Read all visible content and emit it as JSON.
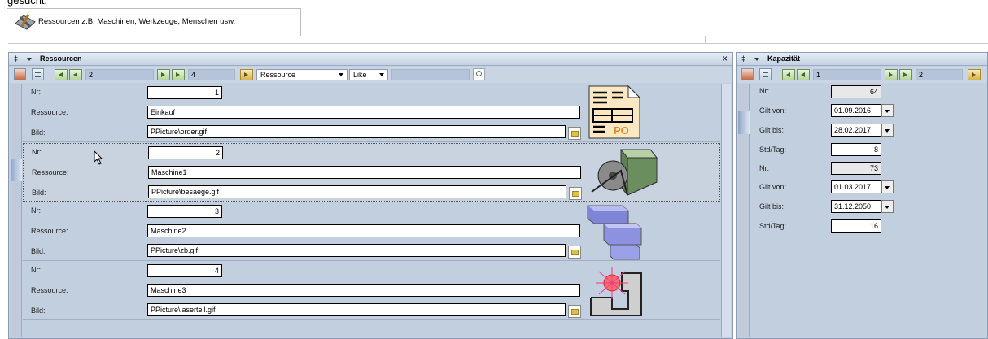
{
  "page_top_text": "gesucht.",
  "tab": {
    "title": "Ressourcen z.B. Maschinen, Werkzeuge, Menschen usw."
  },
  "left_panel": {
    "title": "Ressourcen",
    "close": "×",
    "pin": "‡",
    "toolbar": {
      "record_pos": "2",
      "record_count": "4",
      "search_field_select": "Ressource",
      "operator_select": "Like"
    },
    "labels": {
      "nr": "Nr:",
      "ressource": "Ressource:",
      "bild": "Bild:"
    },
    "records": [
      {
        "nr": "1",
        "ressource": "Einkauf",
        "bild": "PPicture\\order.gif",
        "image": "order-icon"
      },
      {
        "nr": "2",
        "ressource": "Maschine1",
        "bild": "PPicture\\besaege.gif",
        "image": "saw-machine-icon"
      },
      {
        "nr": "3",
        "ressource": "Maschine2",
        "bild": "PPicture\\zb.gif",
        "image": "blocks-icon"
      },
      {
        "nr": "4",
        "ressource": "Maschine3",
        "bild": "PPicture\\laserteil.gif",
        "image": "laser-part-icon"
      }
    ]
  },
  "right_panel": {
    "title": "Kapazität",
    "pin": "‡",
    "toolbar": {
      "record_pos": "1",
      "record_count": "2"
    },
    "labels": {
      "nr": "Nr:",
      "gilt_von": "Gilt von:",
      "gilt_bis": "Gilt bis:",
      "std_tag": "Std/Tag:"
    },
    "records": [
      {
        "nr": "64",
        "gilt_von": "01.09.2016",
        "gilt_bis": "28.02.2017",
        "std_tag": "8"
      },
      {
        "nr": "73",
        "gilt_von": "01.03.2017",
        "gilt_bis": "31.12.2050",
        "std_tag": "16"
      }
    ]
  }
}
